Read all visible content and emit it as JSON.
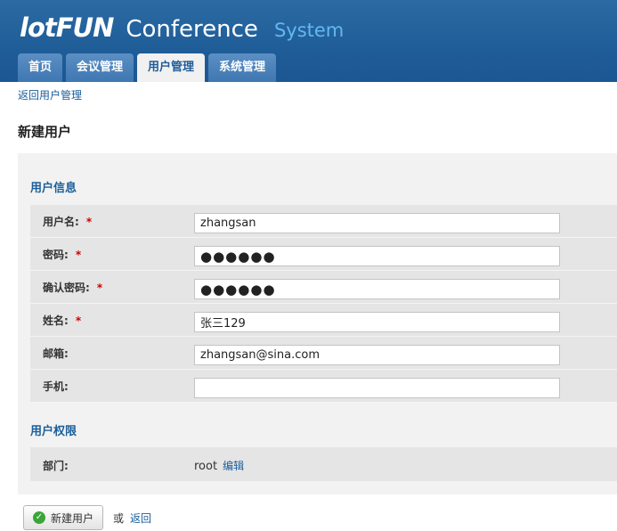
{
  "header": {
    "logo": "lotFUN",
    "title": "Conference",
    "subtitle": "System"
  },
  "tabs": [
    {
      "label": "首页",
      "active": false
    },
    {
      "label": "会议管理",
      "active": false
    },
    {
      "label": "用户管理",
      "active": true
    },
    {
      "label": "系统管理",
      "active": false
    }
  ],
  "breadcrumb": {
    "back_link": "返回用户管理"
  },
  "page_title": "新建用户",
  "user_info": {
    "section_title": "用户信息",
    "fields": [
      {
        "label": "用户名:",
        "required": "*",
        "value": "zhangsan"
      },
      {
        "label": "密码:",
        "required": "*",
        "value": "●●●●●●"
      },
      {
        "label": "确认密码:",
        "required": "*",
        "value": "●●●●●●"
      },
      {
        "label": "姓名:",
        "required": "*",
        "value": "张三129"
      },
      {
        "label": "邮箱:",
        "required": "",
        "value": "zhangsan@sina.com"
      },
      {
        "label": "手机:",
        "required": "",
        "value": ""
      }
    ]
  },
  "permissions": {
    "section_title": "用户权限",
    "department_label": "部门:",
    "department_value": "root",
    "edit_link": "编辑"
  },
  "actions": {
    "submit_label": "新建用户",
    "or_text": "或",
    "back_label": "返回"
  },
  "colors": {
    "header_bg": "#1f5d98",
    "accent": "#1a5e9a",
    "required": "#cc0000"
  }
}
